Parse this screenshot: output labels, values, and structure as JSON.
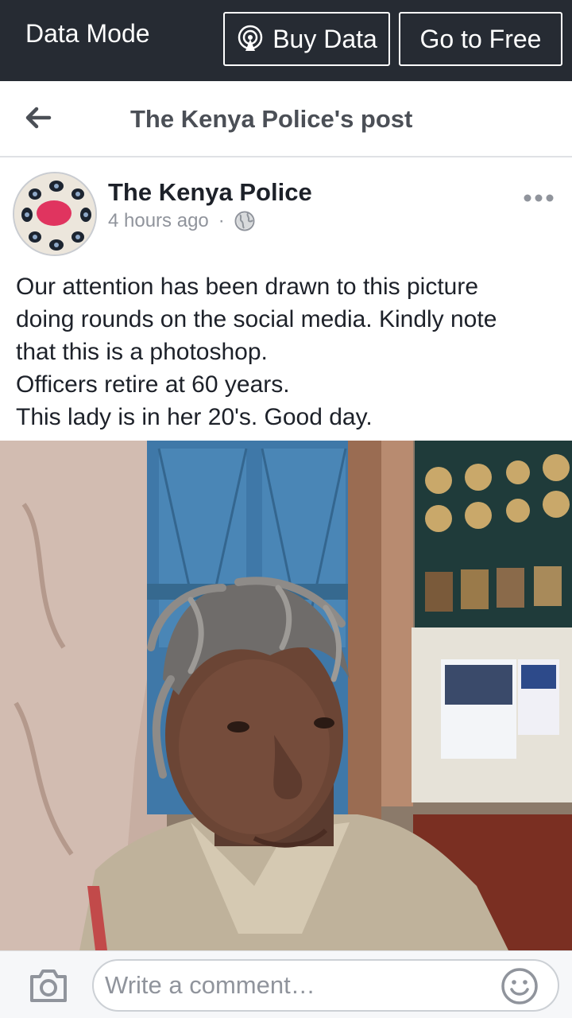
{
  "topbar": {
    "mode_label": "Data Mode",
    "buy_data_label": "Buy Data",
    "go_free_label": "Go to Free"
  },
  "header": {
    "title": "The Kenya Police's post"
  },
  "post": {
    "author": "The Kenya Police",
    "time": "4 hours ago",
    "separator": "·",
    "visibility_icon": "globe-icon",
    "text_lines": [
      "Our attention has been drawn to this picture",
      "doing rounds on the social media. Kindly note",
      "that this is a photoshop.",
      "Officers retire at 60 years.",
      "This lady is in her 20's. Good day."
    ]
  },
  "comment": {
    "placeholder": "Write a comment…"
  },
  "colors": {
    "topbar_bg": "#262b33",
    "title_text": "#4b4f56",
    "body_text": "#1d2129",
    "meta_text": "#90949c"
  }
}
